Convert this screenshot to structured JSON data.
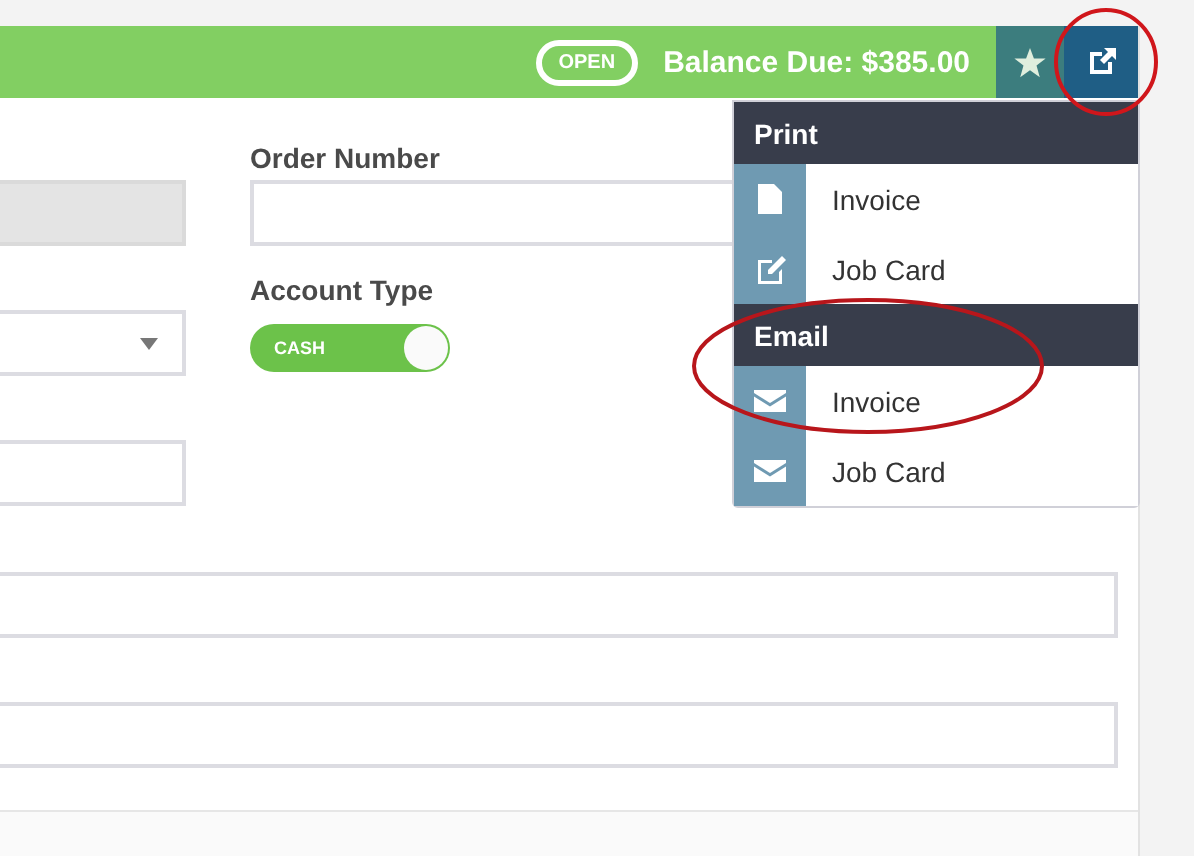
{
  "header": {
    "status_badge": "OPEN",
    "balance": "Balance Due: $385.00"
  },
  "form": {
    "left_fields": [
      {
        "kind": "input",
        "disabled": true
      },
      {
        "kind": "select",
        "disabled": false
      },
      {
        "kind": "input",
        "disabled": false
      }
    ],
    "order_number": {
      "label": "Order Number"
    },
    "account_type": {
      "label": "Account Type",
      "value": "CASH",
      "on": true
    },
    "wide_fields": [
      {
        "kind": "input",
        "disabled": false
      },
      {
        "kind": "input",
        "disabled": false
      }
    ]
  },
  "menu": {
    "sections": [
      {
        "title": "Print",
        "items": [
          {
            "label": "Invoice",
            "kind": "file"
          },
          {
            "label": "Job Card",
            "kind": "edit"
          }
        ]
      },
      {
        "title": "Email",
        "items": [
          {
            "label": "Invoice",
            "kind": "mail"
          },
          {
            "label": "Job Card",
            "kind": "mail"
          }
        ]
      }
    ]
  }
}
